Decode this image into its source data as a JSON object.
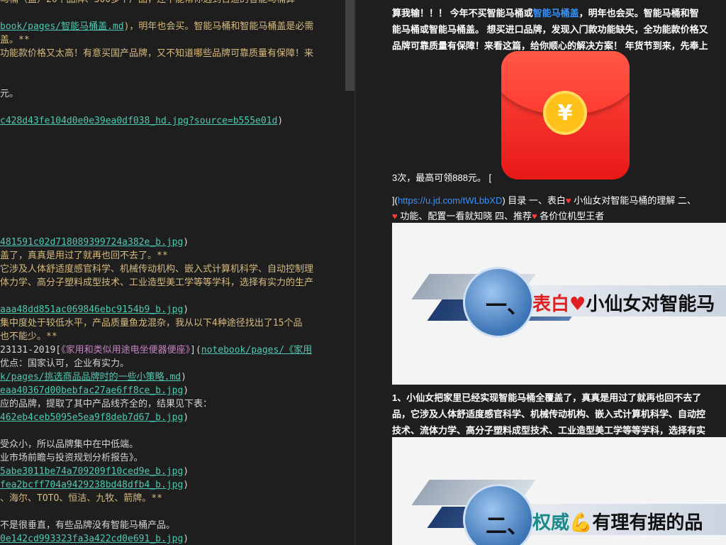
{
  "editor": {
    "lines": [
      {
        "segments": [
          {
            "t": "马桶（盖）26个品牌、300多个产品，还不能帮你选到合适的智能马桶算",
            "c": "yel"
          }
        ]
      },
      {
        "segments": [
          {
            "t": "",
            "c": "wht"
          }
        ]
      },
      {
        "segments": [
          {
            "t": "book/pages/智能马桶盖.md",
            "c": "link"
          },
          {
            "t": ")，明年也会买。智能马桶和智能马桶盖是必需",
            "c": "yel"
          }
        ]
      },
      {
        "segments": [
          {
            "t": "盖。**",
            "c": "yel"
          }
        ]
      },
      {
        "segments": [
          {
            "t": "功能款价格又太高！有意买国产品牌，又不知道哪些品牌可靠质量有保障！来",
            "c": "yel"
          }
        ]
      },
      {
        "segments": [
          {
            "t": "",
            "c": "wht"
          }
        ]
      },
      {
        "segments": [
          {
            "t": "",
            "c": "wht"
          }
        ]
      },
      {
        "segments": [
          {
            "t": "元。",
            "c": "wht"
          }
        ]
      },
      {
        "segments": [
          {
            "t": "",
            "c": "wht"
          }
        ]
      },
      {
        "segments": [
          {
            "t": "c428d43fe104d0e0e39ea0df038_hd.jpg?source=b555e01d",
            "c": "link"
          },
          {
            "t": ")",
            "c": "wht"
          }
        ]
      },
      {
        "segments": [
          {
            "t": "",
            "c": "wht"
          }
        ]
      },
      {
        "segments": [
          {
            "t": "",
            "c": "wht"
          }
        ]
      },
      {
        "segments": [
          {
            "t": "",
            "c": "wht"
          }
        ]
      },
      {
        "segments": [
          {
            "t": "",
            "c": "wht"
          }
        ]
      },
      {
        "segments": [
          {
            "t": "",
            "c": "wht"
          }
        ]
      },
      {
        "segments": [
          {
            "t": "",
            "c": "wht"
          }
        ]
      },
      {
        "segments": [
          {
            "t": "",
            "c": "wht"
          }
        ]
      },
      {
        "segments": [
          {
            "t": "",
            "c": "wht"
          }
        ]
      },
      {
        "segments": [
          {
            "t": "481591c02d718089399724a382e_b.jpg",
            "c": "link"
          },
          {
            "t": ")",
            "c": "wht"
          }
        ]
      },
      {
        "segments": [
          {
            "t": "盖了，真真是用过了就再也回不去了。**",
            "c": "yel"
          }
        ]
      },
      {
        "segments": [
          {
            "t": "它涉及人体舒适度感官科学、机械传动机构、嵌入式计算机科学、自动控制理",
            "c": "yel"
          }
        ]
      },
      {
        "segments": [
          {
            "t": "体力学、高分子塑料成型技术、工业造型美工学等等学科，选择有实力的生产",
            "c": "yel"
          }
        ]
      },
      {
        "segments": [
          {
            "t": "",
            "c": "wht"
          }
        ]
      },
      {
        "segments": [
          {
            "t": "aaa48dd851ac069846ebc9154b9_b.jpg",
            "c": "link"
          },
          {
            "t": ")",
            "c": "wht"
          }
        ]
      },
      {
        "segments": [
          {
            "t": "集中度处于较低水平，产品质量鱼龙混杂，我从以下4种途径找出了15个品",
            "c": "yel"
          }
        ]
      },
      {
        "segments": [
          {
            "t": "也不能少。**",
            "c": "yel"
          }
        ]
      },
      {
        "segments": [
          {
            "t": "23131-2019[",
            "c": "wht"
          },
          {
            "t": "《家用和类似用途电坐便器便座》",
            "c": "violet"
          },
          {
            "t": "](",
            "c": "wht"
          },
          {
            "t": "notebook/pages/《家用",
            "c": "link"
          }
        ]
      },
      {
        "segments": [
          {
            "t": "优点：国家认可，企业有实力。",
            "c": "wht"
          }
        ]
      },
      {
        "segments": [
          {
            "t": "k/pages/挑选商品品牌时的一些小策略.md",
            "c": "link"
          },
          {
            "t": ")",
            "c": "wht"
          }
        ]
      },
      {
        "segments": [
          {
            "t": "eaa40367d00bebfac27ae6ff8ce_b.jpg",
            "c": "link"
          },
          {
            "t": ")",
            "c": "wht"
          }
        ]
      },
      {
        "segments": [
          {
            "t": "应的品牌，提取了其中产品线齐全的，结果见下表：",
            "c": "wht"
          }
        ]
      },
      {
        "segments": [
          {
            "t": "462eb4ceb5095e5ea9f8deb7d67_b.jpg",
            "c": "link"
          },
          {
            "t": ")",
            "c": "wht"
          }
        ]
      },
      {
        "segments": [
          {
            "t": "",
            "c": "wht"
          }
        ]
      },
      {
        "segments": [
          {
            "t": "受众小，所以品牌集中在中低端。",
            "c": "wht"
          }
        ]
      },
      {
        "segments": [
          {
            "t": "业市场前瞻与投资规划分析报告》。",
            "c": "wht"
          }
        ]
      },
      {
        "segments": [
          {
            "t": "5abe3011be74a709209f10ced9e_b.jpg",
            "c": "link"
          },
          {
            "t": ")",
            "c": "wht"
          }
        ]
      },
      {
        "segments": [
          {
            "t": "fea2bcff704a9429238bd48dfb4_b.jpg",
            "c": "link"
          },
          {
            "t": ")",
            "c": "wht"
          }
        ]
      },
      {
        "segments": [
          {
            "t": "、海尔、TOTO、恒洁、九牧、箭牌。**",
            "c": "yel"
          }
        ]
      },
      {
        "segments": [
          {
            "t": "",
            "c": "wht"
          }
        ]
      },
      {
        "segments": [
          {
            "t": "不是很垂直，有些品牌没有智能马桶产品。",
            "c": "wht"
          }
        ]
      },
      {
        "segments": [
          {
            "t": "0e142cd993323fa3a422cd0e691_b.jpg",
            "c": "link"
          },
          {
            "t": ")",
            "c": "wht"
          }
        ]
      }
    ]
  },
  "preview": {
    "line1_a": "算我输！！！ 今年不买智能马桶或",
    "line1_link": "智能马桶盖",
    "line1_b": "，明年也会买。智能马桶和智",
    "line2": "能马桶或智能马桶盖。 想买进口品牌，发现入门款功能缺失，全功能款价格又",
    "line3": "品牌可靠质量有保障！来看这篇，给你顺心的解决方案！ 年货节到来，先奉上",
    "envelope_symbol": "¥",
    "line4": "3次，最高可领888元。 [",
    "line5_a": "](",
    "line5_link": "https://u.jd.com/tWLbbXD",
    "line5_b": ") 目录 一、表白",
    "line5_c": " 小仙女对智能马桶的理解 二、",
    "line6_a": " 功能、配置一看就知晓 四、推荐",
    "line6_b": " 各价位机型王者",
    "heart": "♥",
    "banner1": {
      "num": "一、",
      "red": "表白",
      "emoji": "♥",
      "rest": "小仙女对智能马"
    },
    "line7": "1、小仙女把家里已经实现智能马桶全覆盖了，真真是用过了就再也回不去了",
    "line8": "品，它涉及人体舒适度感官科学、机械传动机构、嵌入式计算机科学、自动控",
    "line9": "技术、流体力学、高分子塑料成型技术、工业造型美工学等等学科，选择有实",
    "banner2": {
      "num": "二、",
      "teal": "权威",
      "emoji": "💪",
      "rest": "有理有据的品"
    }
  },
  "colors": {
    "editor_bg": "#1e1e1e",
    "link": "#4ec9b0",
    "bold_yellow": "#d7ba7d",
    "preview_link": "#3794ff"
  }
}
